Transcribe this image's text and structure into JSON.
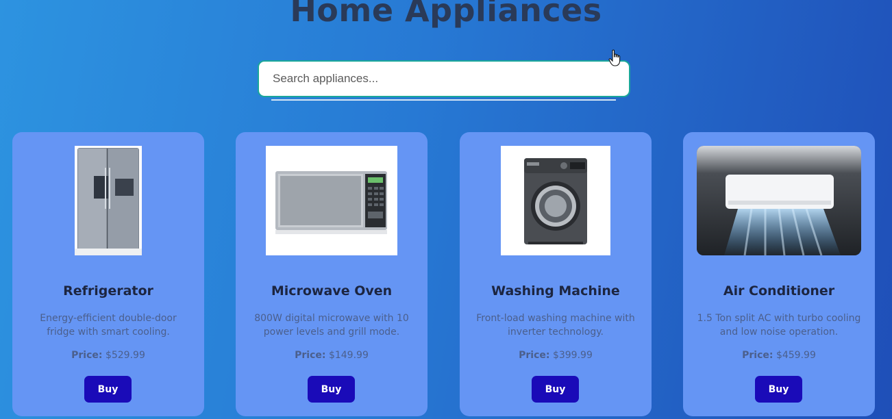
{
  "page": {
    "title": "Home Appliances"
  },
  "search": {
    "placeholder": "Search appliances..."
  },
  "products": [
    {
      "name": "Refrigerator",
      "description": "Energy-efficient double-door fridge with smart cooling.",
      "price_label": "Price:",
      "price": "$529.99",
      "buy_label": "Buy",
      "icon": "refrigerator-image"
    },
    {
      "name": "Microwave Oven",
      "description": "800W digital microwave with 10 power levels and grill mode.",
      "price_label": "Price:",
      "price": "$149.99",
      "buy_label": "Buy",
      "icon": "microwave-image"
    },
    {
      "name": "Washing Machine",
      "description": "Front-load washing machine with inverter technology.",
      "price_label": "Price:",
      "price": "$399.99",
      "buy_label": "Buy",
      "icon": "washing-machine-image"
    },
    {
      "name": "Air Conditioner",
      "description": "1.5 Ton split AC with turbo cooling and low noise operation.",
      "price_label": "Price:",
      "price": "$459.99",
      "buy_label": "Buy",
      "icon": "air-conditioner-image"
    }
  ],
  "colors": {
    "card_bg": "#6595f4",
    "buy_button": "#1a0bb8",
    "search_border": "#1aa79a",
    "title": "#2a3a58"
  }
}
